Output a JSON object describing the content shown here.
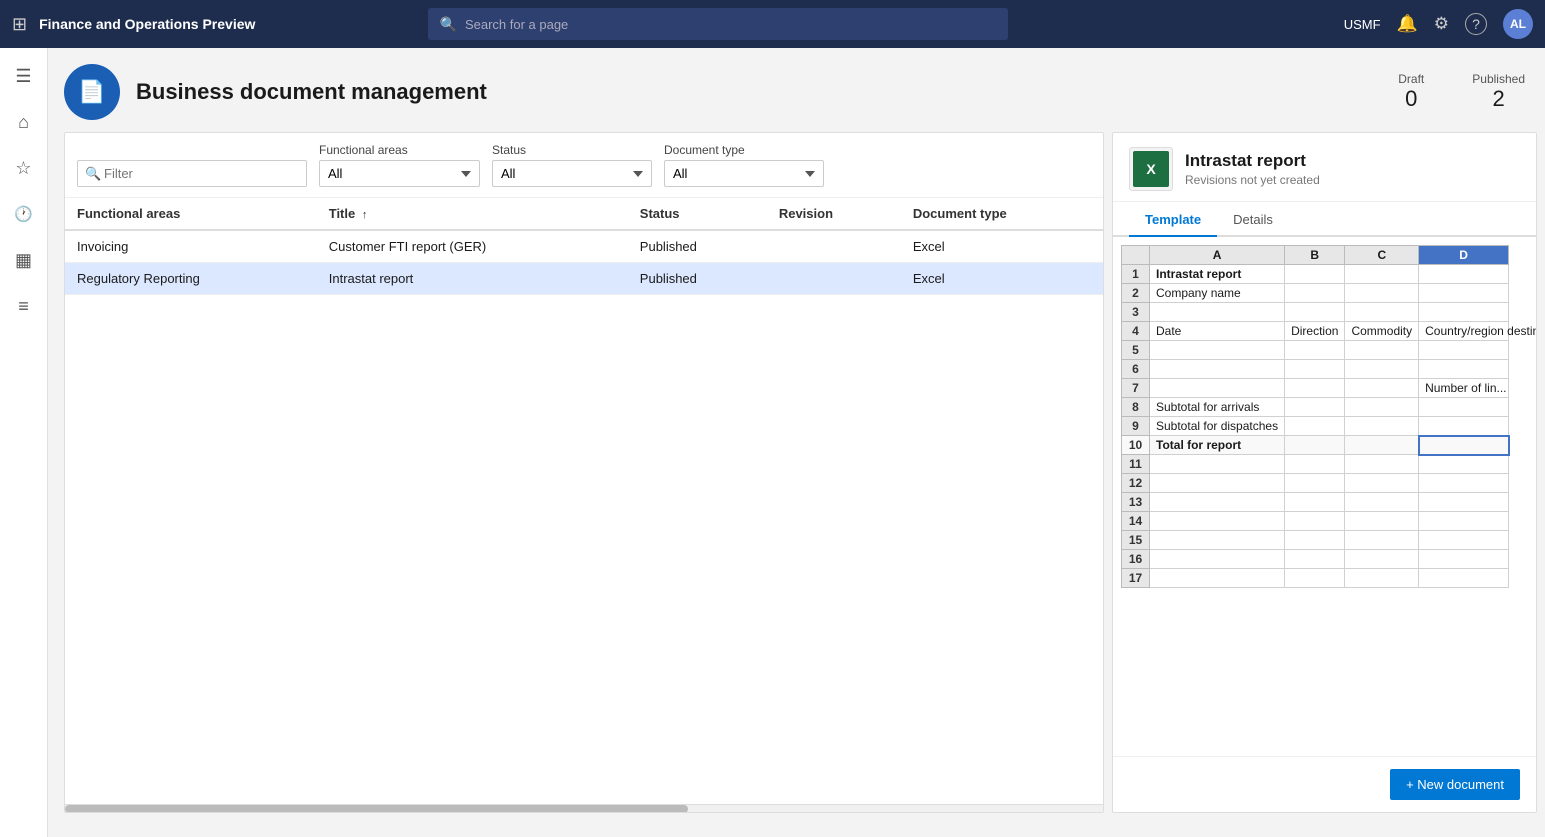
{
  "app": {
    "title": "Finance and Operations Preview",
    "company": "USMF"
  },
  "search": {
    "placeholder": "Search for a page"
  },
  "header": {
    "page_icon_label": "BM",
    "page_title": "Business document management",
    "draft_label": "Draft",
    "draft_count": "0",
    "published_label": "Published",
    "published_count": "2"
  },
  "filters": {
    "filter_placeholder": "Filter",
    "functional_areas_label": "Functional areas",
    "functional_areas_value": "All",
    "status_label": "Status",
    "status_value": "All",
    "document_type_label": "Document type",
    "document_type_value": "All"
  },
  "table": {
    "columns": [
      "Functional areas",
      "Title",
      "Status",
      "Revision",
      "Document type"
    ],
    "title_sort_icon": "↑",
    "rows": [
      {
        "functional_area": "Invoicing",
        "title": "Customer FTI report (GER)",
        "status": "Published",
        "revision": "",
        "document_type": "Excel",
        "selected": false
      },
      {
        "functional_area": "Regulatory Reporting",
        "title": "Intrastat report",
        "status": "Published",
        "revision": "",
        "document_type": "Excel",
        "selected": true
      }
    ]
  },
  "right_panel": {
    "title": "Intrastat report",
    "subtitle": "Revisions not yet created",
    "tab_template": "Template",
    "tab_details": "Details",
    "active_tab": "Template",
    "new_doc_btn": "+ New document",
    "excel": {
      "col_headers": [
        "",
        "A",
        "B",
        "C",
        "D"
      ],
      "active_col": "D",
      "rows": [
        {
          "num": "1",
          "cells": [
            {
              "text": "Intrastat report",
              "bold": true
            },
            "",
            "",
            ""
          ]
        },
        {
          "num": "2",
          "cells": [
            {
              "text": "Company name"
            },
            "",
            "",
            ""
          ]
        },
        {
          "num": "3",
          "cells": [
            "",
            "",
            "",
            ""
          ]
        },
        {
          "num": "4",
          "cells": [
            {
              "text": "Date"
            },
            {
              "text": "Direction"
            },
            {
              "text": "Commodity"
            },
            {
              "text": "Country/region destination",
              "truncated": true
            }
          ]
        },
        {
          "num": "5",
          "cells": [
            "",
            "",
            "",
            ""
          ]
        },
        {
          "num": "6",
          "cells": [
            "",
            "",
            "",
            ""
          ]
        },
        {
          "num": "7",
          "cells": [
            "",
            "",
            "",
            {
              "text": "Number of lin...",
              "truncated": true
            }
          ]
        },
        {
          "num": "8",
          "cells": [
            {
              "text": "Subtotal for arrivals"
            },
            "",
            "",
            ""
          ]
        },
        {
          "num": "9",
          "cells": [
            {
              "text": "Subtotal for dispatches"
            },
            "",
            "",
            ""
          ]
        },
        {
          "num": "10",
          "cells": [
            {
              "text": "Total for report",
              "bold": true
            },
            "",
            "",
            {
              "text": "",
              "active_outline": true
            }
          ],
          "highlight": true
        },
        {
          "num": "11",
          "cells": [
            "",
            "",
            "",
            ""
          ]
        },
        {
          "num": "12",
          "cells": [
            "",
            "",
            "",
            ""
          ]
        },
        {
          "num": "13",
          "cells": [
            "",
            "",
            "",
            ""
          ]
        },
        {
          "num": "14",
          "cells": [
            "",
            "",
            "",
            ""
          ]
        },
        {
          "num": "15",
          "cells": [
            "",
            "",
            "",
            ""
          ]
        },
        {
          "num": "16",
          "cells": [
            "",
            "",
            "",
            ""
          ]
        },
        {
          "num": "17",
          "cells": [
            "",
            "",
            "",
            ""
          ]
        }
      ]
    }
  },
  "icons": {
    "grid": "⊞",
    "hamburger": "☰",
    "home": "⌂",
    "star": "☆",
    "clock": "🕐",
    "table": "▦",
    "list": "≡",
    "bell": "🔔",
    "gear": "⚙",
    "question": "?",
    "search": "🔍",
    "filter": "⊘",
    "plus": "+"
  }
}
